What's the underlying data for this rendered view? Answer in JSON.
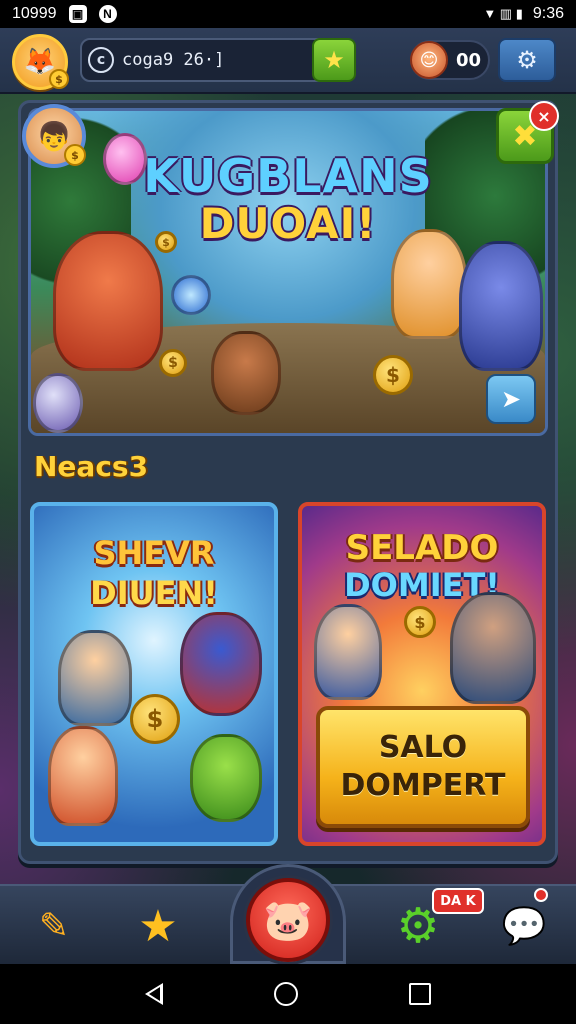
{
  "status_bar": {
    "time_left": "10999",
    "icon_1": "gallery-icon",
    "icon_2": "n-icon",
    "icon_1_glyph": "▣",
    "icon_2_glyph": "N",
    "signal_glyphs": "▼ ▥ ▮",
    "clock": "9:36"
  },
  "top_bar": {
    "search_text": "coga9 26·]",
    "search_icon_glyph": "c",
    "star_glyph": "★",
    "avatar_glyph": "🦊",
    "coin_glyph": "$",
    "counter_value": "00",
    "counter_face_glyph": "😊",
    "settings_glyph": "⚙"
  },
  "hero": {
    "title_line1": "KUGBLANS",
    "title_line2": "DUOAI!",
    "avatar_glyph": "👦",
    "coin_glyph": "$",
    "close_glyph": "✖",
    "badge_glyph": "×",
    "share_glyph": "➤"
  },
  "section": {
    "heading": "Neacs3"
  },
  "cards": {
    "left": {
      "title_line1": "SHEVR",
      "title_line2": "DIUEN!",
      "coin_glyph": "$"
    },
    "right": {
      "title_line1": "SELADO",
      "title_line2": "DOMIET!",
      "coin_glyph": "$",
      "cta_line1": "SALO",
      "cta_line2": "DOMPERT"
    }
  },
  "bottom_nav": {
    "items": [
      {
        "icon": "pencil-icon",
        "glyph": "✎"
      },
      {
        "icon": "star-icon",
        "glyph": "★"
      },
      {
        "icon": "pig-icon",
        "glyph": "🐷"
      },
      {
        "icon": "gear-icon",
        "glyph": "⚙"
      },
      {
        "icon": "chat-icon",
        "glyph": "💬"
      }
    ],
    "badge_text": "DA K"
  },
  "colors": {
    "accent_gold": "#ffd23a",
    "accent_red": "#d0201a",
    "panel": "#2b3a4f"
  }
}
